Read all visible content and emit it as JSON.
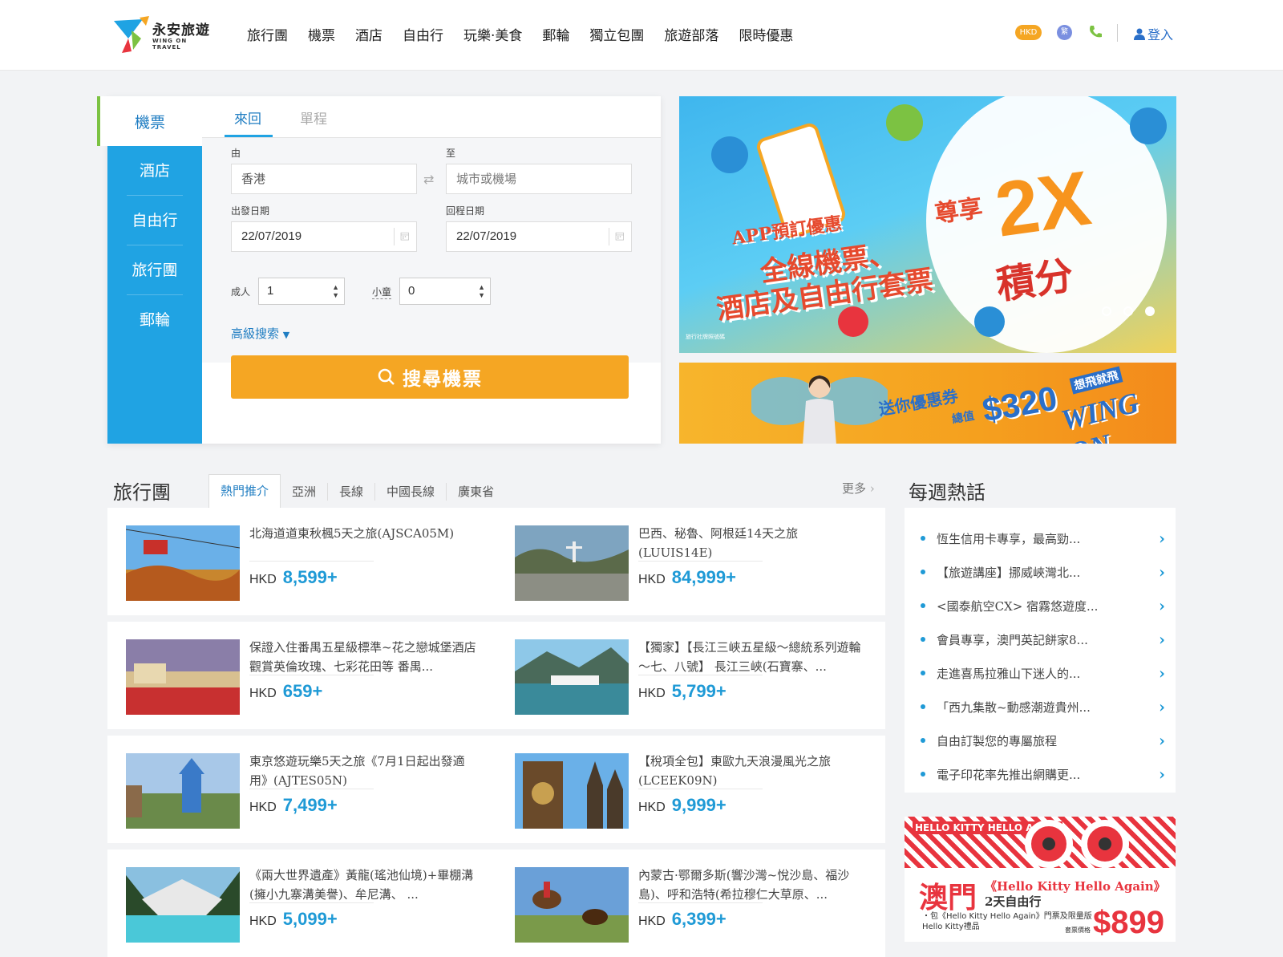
{
  "header": {
    "logo_cn": "永安旅遊",
    "logo_en": "WING ON TRAVEL",
    "nav": [
      "旅行團",
      "機票",
      "酒店",
      "自由行",
      "玩樂·美食",
      "郵輪",
      "獨立包團",
      "旅遊部落",
      "限時優惠"
    ],
    "currency": "HKD",
    "lang": "繁",
    "login": "登入"
  },
  "search": {
    "side_items": [
      "機票",
      "酒店",
      "自由行",
      "旅行團",
      "郵輪"
    ],
    "active_side": "機票",
    "tabs": [
      "來回",
      "單程"
    ],
    "from_label": "由",
    "from_value": "香港",
    "to_label": "至",
    "to_placeholder": "城市或機場",
    "depart_label": "出發日期",
    "depart_value": "22/07/2019",
    "return_label": "回程日期",
    "return_value": "22/07/2019",
    "adult_label": "成人",
    "adult_value": "1",
    "child_label": "小童",
    "child_value": "0",
    "advanced": "高級搜索",
    "button": "搜尋機票"
  },
  "banner1": {
    "line1": "APP預訂優惠",
    "line2": "全線機票、",
    "line3": "酒店及自由行套票",
    "line4": "尊享",
    "line5": "2X",
    "line6": "積分",
    "small": "旅行社牌照號碼",
    "dots": 3,
    "active_dot": 3
  },
  "banner2": {
    "t1": "送你優惠券",
    "t2": "總值",
    "t3": "$320",
    "t4": "WING ON",
    "t5": "想飛就飛"
  },
  "tours": {
    "title": "旅行團",
    "tabs": [
      "熱門推介",
      "亞洲",
      "長線",
      "中國長線",
      "廣東省"
    ],
    "more": "更多",
    "currency": "HKD",
    "items": [
      {
        "title": "北海道道東秋楓5天之旅(AJSCA05M)",
        "price": "8,599+"
      },
      {
        "title": "巴西、秘魯、阿根廷14天之旅(LUUIS14E)",
        "price": "84,999+"
      },
      {
        "title": "保證入住番禺五星級標準~花之戀城堡酒店 觀賞英倫玫瑰、七彩花田等 番禺...",
        "price": "659+"
      },
      {
        "title": "【獨家】【長江三峽五星級～總統系列遊輪～七、八號】 長江三峽(石寶寨、...",
        "price": "5,799+"
      },
      {
        "title": "東京悠遊玩樂5天之旅《7月1日起出發適用》(AJTES05N)",
        "price": "7,499+"
      },
      {
        "title": "【稅項全包】東歐九天浪漫風光之旅(LCEEK09N)",
        "price": "9,999+"
      },
      {
        "title": "《兩大世界遺產》黃龍(瑤池仙境)+畢棚溝(擁小九寨溝美譽)、牟尼溝、 ...",
        "price": "5,099+"
      },
      {
        "title": "內蒙古·鄂爾多斯(響沙灣~悅沙島、福沙島)、呼和浩特(希拉穆仁大草原、...",
        "price": "6,399+"
      }
    ]
  },
  "weekly": {
    "title": "每週熱話",
    "items": [
      "恆生信用卡專享，最高勁...",
      "【旅遊講座】挪威峽灣北...",
      "<國泰航空CX> 宿霧悠遊度...",
      "會員專享，澳門英記餅家8...",
      "走進喜馬拉雅山下迷人的...",
      "「西九集散~動感潮遊貴州...",
      "自由訂製您的專屬旅程",
      "電子印花率先推出網購更..."
    ]
  },
  "ad": {
    "hk": "HELLO KITTY HELLO AGAIN",
    "city": "澳門",
    "name": "《Hello Kitty Hello Again》",
    "days": "2天自由行",
    "detail": "・包《Hello Kitty Hello Again》門票及限量版Hello Kitty禮品",
    "price": "$899",
    "note": "套票價格"
  },
  "colors": {
    "accent_blue": "#20a3e3",
    "orange": "#f5a623",
    "price_blue": "#1f9ad6",
    "green": "#7cc242"
  }
}
